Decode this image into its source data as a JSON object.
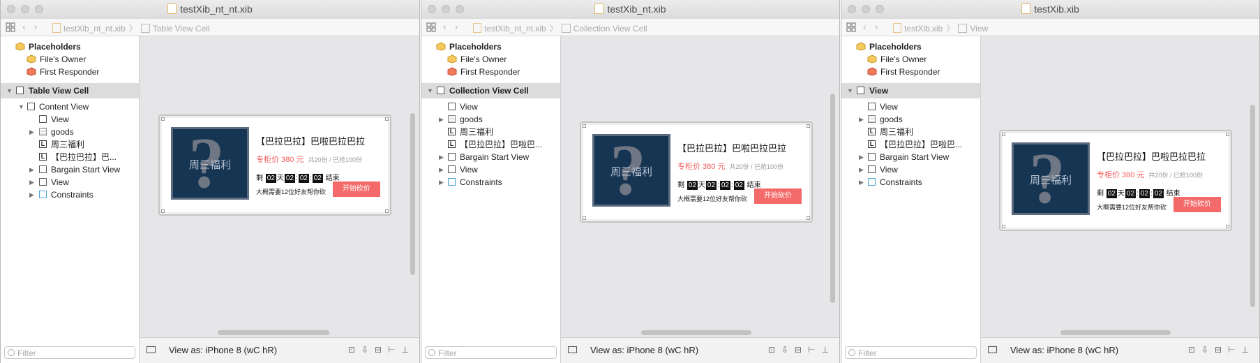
{
  "windows": [
    {
      "title": "testXib_nt_nt.xib",
      "breadcrumb_file": "testXib_nt_nt.xib",
      "breadcrumb_object": "Table View Cell",
      "placeholders_label": "Placeholders",
      "owner_label": "File's Owner",
      "responder_label": "First Responder",
      "root_label": "Table View Cell",
      "content_view_label": "Content View",
      "children": [
        "View",
        "goods",
        "周三福利",
        "【巴拉巴拉】巴...",
        "Bargain Start View",
        "View",
        "Constraints"
      ],
      "filter_placeholder": "Filter",
      "view_as": "View as: iPhone 8 (wC hR)"
    },
    {
      "title": "testXib_nt.xib",
      "breadcrumb_file": "testXib_nt_nt.xib",
      "breadcrumb_object": "Collection View Cell",
      "placeholders_label": "Placeholders",
      "owner_label": "File's Owner",
      "responder_label": "First Responder",
      "root_label": "Collection View Cell",
      "children": [
        "View",
        "goods",
        "周三福利",
        "【巴拉巴拉】巴啦巴...",
        "Bargain Start View",
        "View",
        "Constraints"
      ],
      "filter_placeholder": "Filter",
      "view_as": "View as: iPhone 8 (wC hR)"
    },
    {
      "title": "testXib.xib",
      "breadcrumb_file": "testXib.xib",
      "breadcrumb_object": "View",
      "placeholders_label": "Placeholders",
      "owner_label": "File's Owner",
      "responder_label": "First Responder",
      "root_label": "View",
      "children": [
        "View",
        "goods",
        "周三福利",
        "【巴拉巴拉】巴啦巴...",
        "Bargain Start View",
        "View",
        "Constraints"
      ],
      "filter_placeholder": "Filter",
      "view_as": "View as: iPhone 8 (wC hR)"
    }
  ],
  "card": {
    "image_watermark": "周三福利",
    "title": "【巴拉巴拉】巴啦巴拉巴拉",
    "price": "专柜价 380 元",
    "stock_meta": "共20份 / 已抢100份",
    "countdown_prefix": "剩",
    "days": "02",
    "days_unit": "天",
    "hours": "02",
    "minutes": "02",
    "seconds": "02",
    "countdown_suffix": "结束",
    "note": "大概需要12位好友帮你砍",
    "button_label": "开始砍价"
  }
}
